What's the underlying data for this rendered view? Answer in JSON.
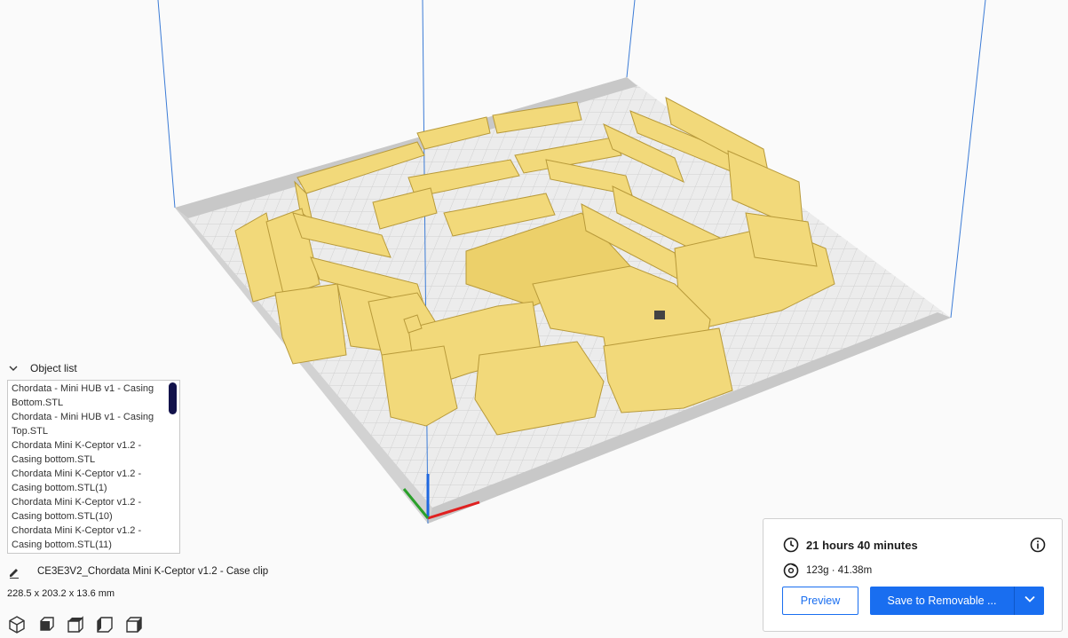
{
  "object_list": {
    "header": "Object list",
    "items": [
      "Chordata - Mini HUB v1 - Casing Bottom.STL",
      "Chordata - Mini HUB v1 - Casing Top.STL",
      "Chordata Mini K-Ceptor v1.2 - Casing bottom.STL",
      "Chordata Mini K-Ceptor v1.2 - Casing bottom.STL(1)",
      "Chordata Mini K-Ceptor v1.2 - Casing bottom.STL(10)",
      "Chordata Mini K-Ceptor v1.2 - Casing bottom.STL(11)"
    ]
  },
  "selected_object": {
    "name": "CE3E3V2_Chordata Mini K-Ceptor v1.2 - Case clip",
    "dimensions": "228.5 x 203.2 x 13.6 mm"
  },
  "view_buttons": [
    "3d-view-icon",
    "front-view-icon",
    "top-view-icon",
    "left-view-icon",
    "right-view-icon"
  ],
  "print_info": {
    "time": "21 hours 40 minutes",
    "material": "123g · 41.38m",
    "preview_label": "Preview",
    "save_label": "Save to Removable ..."
  },
  "colors": {
    "accent": "#196ef0",
    "model": "#f2d97a",
    "build_volume_edge": "#3b7bd6",
    "buildplate": "#e6e6e6"
  }
}
